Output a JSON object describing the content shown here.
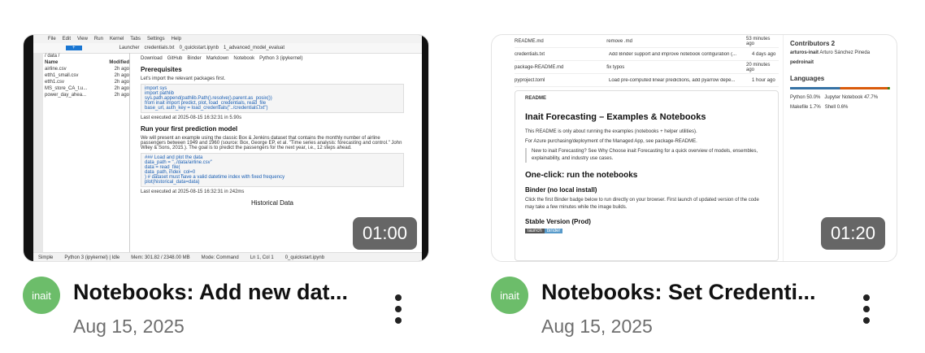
{
  "videos": [
    {
      "duration": "01:00",
      "channel": "inait",
      "title": "Notebooks: Add new dat...",
      "date": "Aug 15, 2025",
      "thumbnail": {
        "menu": [
          "File",
          "Edit",
          "View",
          "Run",
          "Kernel",
          "Tabs",
          "Settings",
          "Help"
        ],
        "tabs": [
          "Launcher",
          "credentials.txt",
          "0_quickstart.ipynb",
          "1_advanced_model_evaluat"
        ],
        "toolbar": [
          "Download",
          "GitHub",
          "Binder",
          "Markdown",
          "Notebook",
          "Python 3 (ipykernel)"
        ],
        "path": "/ data /",
        "file_header": [
          "Name",
          "Modified"
        ],
        "files": [
          {
            "name": "airline.csv",
            "modified": "2h ago"
          },
          {
            "name": "etth1_small.csv",
            "modified": "2h ago"
          },
          {
            "name": "etth1.csv",
            "modified": "2h ago"
          },
          {
            "name": "MS_store_CA_t.u...",
            "modified": "2h ago"
          },
          {
            "name": "power_day_ahea...",
            "modified": "2h ago"
          }
        ],
        "heading1": "Prerequisites",
        "text1": "Let's import the relevant packages first.",
        "code1": [
          "import sys",
          "import pathlib",
          "",
          "sys.path.append(pathlib.Path().resolve().parent.as_posix())",
          "",
          "from inait import predict, plot, load_credentials, read_file",
          "",
          "base_url, auth_key = load_credentials(\"../credentials.txt\")"
        ],
        "exec1": "Last executed at 2025-08-15 16:32:31 in 5.90s",
        "heading2": "Run your first prediction model",
        "text2": "We will present an example using the classic Box & Jenkins dataset that contains the monthly number of airline passengers between 1949 and 1960 (source: Box, George EP, et al. \"Time series analysis: forecasting and control.\" John Wiley & Sons, 2015.). The goal is to predict the passengers for the next year, i.e., 12 steps ahead.",
        "code2": [
          "### Load and plot the data",
          "data_path = \"../data/airline.csv\"",
          "data = read_file(",
          "    data_path, index_col=0",
          ")  # dataset must have a valid datetime index with fixed frequency",
          "",
          "plot(historical_data=data)"
        ],
        "exec2": "Last executed at 2025-08-15 16:32:31 in 242ms",
        "heading3": "Historical Data",
        "status": [
          "Simple",
          "0",
          "1",
          "Python 3 (ipykernel) | Idle",
          "Mem: 301.82 / 2348.00 MB",
          "Mode: Command",
          "Ln 1, Col 1",
          "0_quickstart.ipynb",
          "0"
        ]
      }
    },
    {
      "duration": "01:20",
      "channel": "inait",
      "title": "Notebooks: Set Credenti...",
      "date": "Aug 15, 2025",
      "thumbnail": {
        "files": [
          {
            "name": "README.md",
            "message": "remove .md",
            "time": "53 minutes ago"
          },
          {
            "name": "credentials.txt",
            "message": "Add Binder support and improve notebook configuration (...",
            "time": "4 days ago"
          },
          {
            "name": "package-README.md",
            "message": "fix typos",
            "time": "20 minutes ago"
          },
          {
            "name": "pyproject.toml",
            "message": "Load pre-computed linear predictions, add pyarrow depe...",
            "time": "1 hour ago"
          }
        ],
        "readme_tab": "README",
        "h1": "Inait Forecasting – Examples & Notebooks",
        "p1": "This README is only about running the examples (notebooks + helper utilities).",
        "p2": "For Azure purchasing/deployment of the Managed App, see package-README.",
        "quote": "New to inait Forecasting? See Why Choose inait Forecasting for a quick overview of models, ensembles, explainability, and industry use cases.",
        "h2": "One-click: run the notebooks",
        "h3": "Binder (no local install)",
        "p3": "Click the first Binder badge below to run directly on your browser. First launch of updated version of the code may take a few minutes while the image builds.",
        "h4": "Stable Version (Prod)",
        "launch": [
          "launch",
          "binder"
        ],
        "contributors_label": "Contributors",
        "contributors_count": "2",
        "contributors": [
          {
            "handle": "arturos-inait",
            "name": "Arturo Sánchez Pineda"
          },
          {
            "handle": "pedroinait",
            "name": ""
          }
        ],
        "languages_label": "Languages",
        "languages": [
          "Python 50.0%",
          "Jupyter Notebook 47.7%",
          "Makefile 1.7%",
          "Shell 0.6%"
        ]
      }
    }
  ]
}
